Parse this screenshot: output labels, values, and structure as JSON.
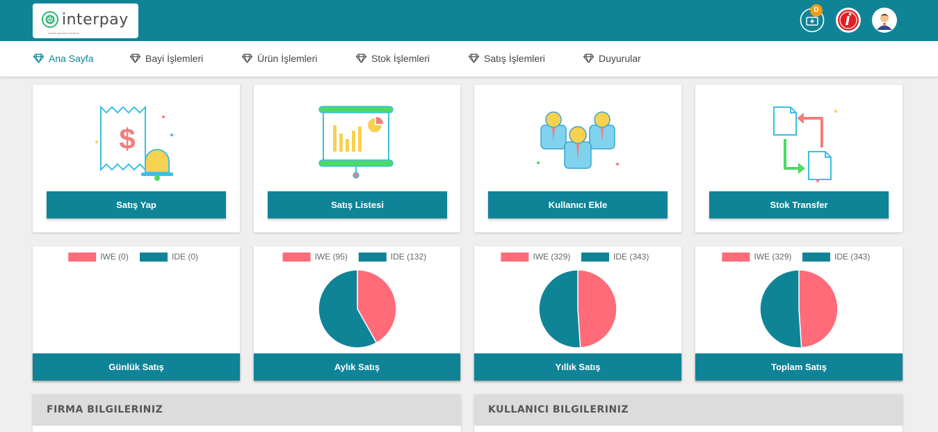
{
  "header": {
    "brand": "interpay",
    "brand_tagline": "mobile payment solutions",
    "notification_badge": "D",
    "colors": {
      "bar": "#0f8497",
      "badge": "#f39c12"
    },
    "icons": [
      "cash-register-icon",
      "info-logo-icon",
      "user-avatar-icon"
    ]
  },
  "nav": {
    "items": [
      {
        "label": "Ana Sayfa",
        "active": true
      },
      {
        "label": "Bayi İşlemleri",
        "active": false
      },
      {
        "label": "Ürün İşlemleri",
        "active": false
      },
      {
        "label": "Stok İşlemleri",
        "active": false
      },
      {
        "label": "Satış İşlemleri",
        "active": false
      },
      {
        "label": "Duyurular",
        "active": false
      }
    ],
    "icon": "diamond-icon",
    "active_color": "#0f8497"
  },
  "actions": [
    {
      "label": "Satış Yap",
      "icon": "receipt-bell-icon"
    },
    {
      "label": "Satış Listesi",
      "icon": "presentation-chart-icon"
    },
    {
      "label": "Kullanıcı Ekle",
      "icon": "users-group-icon"
    },
    {
      "label": "Stok Transfer",
      "icon": "document-transfer-icon"
    }
  ],
  "chart_data": [
    {
      "type": "pie",
      "title": "Günlük Satış",
      "series": [
        {
          "name": "IWE",
          "value": 0
        },
        {
          "name": "IDE",
          "value": 0
        }
      ],
      "legend": [
        "IWE (0)",
        "IDE (0)"
      ],
      "legend_position": "top"
    },
    {
      "type": "pie",
      "title": "Aylık Satış",
      "series": [
        {
          "name": "IWE",
          "value": 95
        },
        {
          "name": "IDE",
          "value": 132
        }
      ],
      "legend": [
        "IWE (95)",
        "IDE (132)"
      ],
      "legend_position": "top"
    },
    {
      "type": "pie",
      "title": "Yıllık Satış",
      "series": [
        {
          "name": "IWE",
          "value": 329
        },
        {
          "name": "IDE",
          "value": 343
        }
      ],
      "legend": [
        "IWE (329)",
        "IDE (343)"
      ],
      "legend_position": "top"
    },
    {
      "type": "pie",
      "title": "Toplam Satış",
      "series": [
        {
          "name": "IWE",
          "value": 329
        },
        {
          "name": "IDE",
          "value": 343
        }
      ],
      "legend": [
        "IWE (329)",
        "IDE (343)"
      ],
      "legend_position": "top"
    }
  ],
  "series_colors": {
    "IWE": "#ff6b78",
    "IDE": "#0f8497"
  },
  "panels": [
    {
      "title": "FIRMA BILGILERINIZ"
    },
    {
      "title": "KULLANICI BILGILERINIZ"
    }
  ]
}
